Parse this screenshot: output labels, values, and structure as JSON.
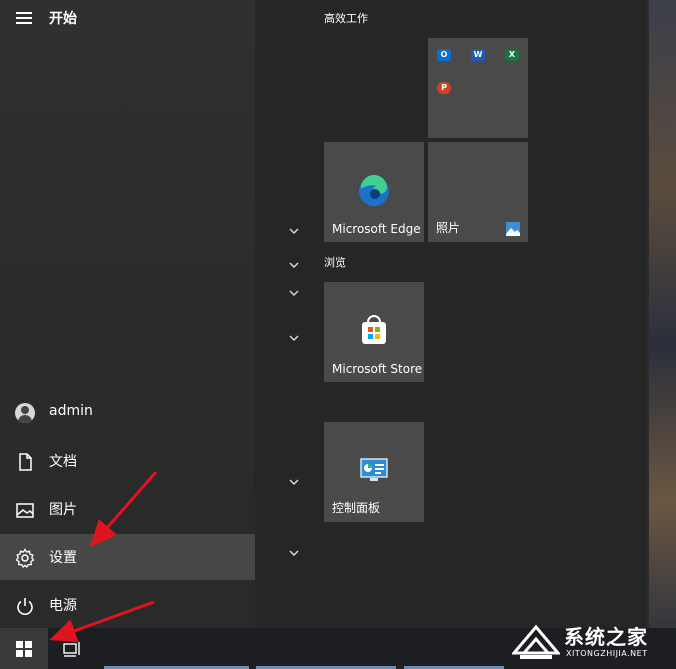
{
  "start_menu": {
    "title": "开始",
    "user": "admin",
    "items": [
      {
        "label": "文档",
        "icon": "document-icon"
      },
      {
        "label": "图片",
        "icon": "pictures-icon"
      },
      {
        "label": "设置",
        "icon": "gear-icon",
        "active": true
      },
      {
        "label": "电源",
        "icon": "power-icon"
      }
    ]
  },
  "groups": {
    "productivity": "高效工作",
    "explore": "浏览"
  },
  "tiles": {
    "office_letters": {
      "outlook": "O",
      "word": "W",
      "excel": "X",
      "powerpoint": "P"
    },
    "edge": "Microsoft Edge",
    "photos": "照片",
    "store": "Microsoft Store",
    "control_panel": "控制面板"
  },
  "watermark": {
    "title": "系统之家",
    "url": "XITONGZHIJIA.NET"
  },
  "colors": {
    "active_item": "#474747",
    "arrow": "#e0141e",
    "tile": "#4a4a4a"
  }
}
